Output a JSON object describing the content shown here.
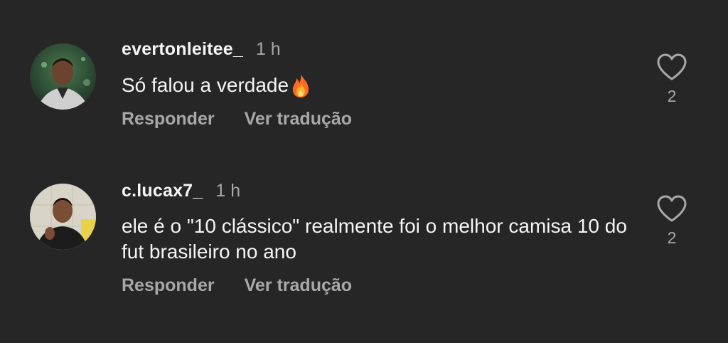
{
  "comments": [
    {
      "username": "evertonleitee_",
      "time": "1 h",
      "text": "Só falou a verdade",
      "emoji": "fire-icon",
      "reply_label": "Responder",
      "translate_label": "Ver tradução",
      "likes": "2"
    },
    {
      "username": "c.lucax7_",
      "time": "1 h",
      "text": "ele é o \"10 clássico\" realmente foi o melhor camisa 10 do fut brasileiro no ano",
      "reply_label": "Responder",
      "translate_label": "Ver tradução",
      "likes": "2"
    }
  ],
  "colors": {
    "background": "#262626",
    "primary_text": "#f5f5f5",
    "secondary_text": "#a8a8a8"
  }
}
